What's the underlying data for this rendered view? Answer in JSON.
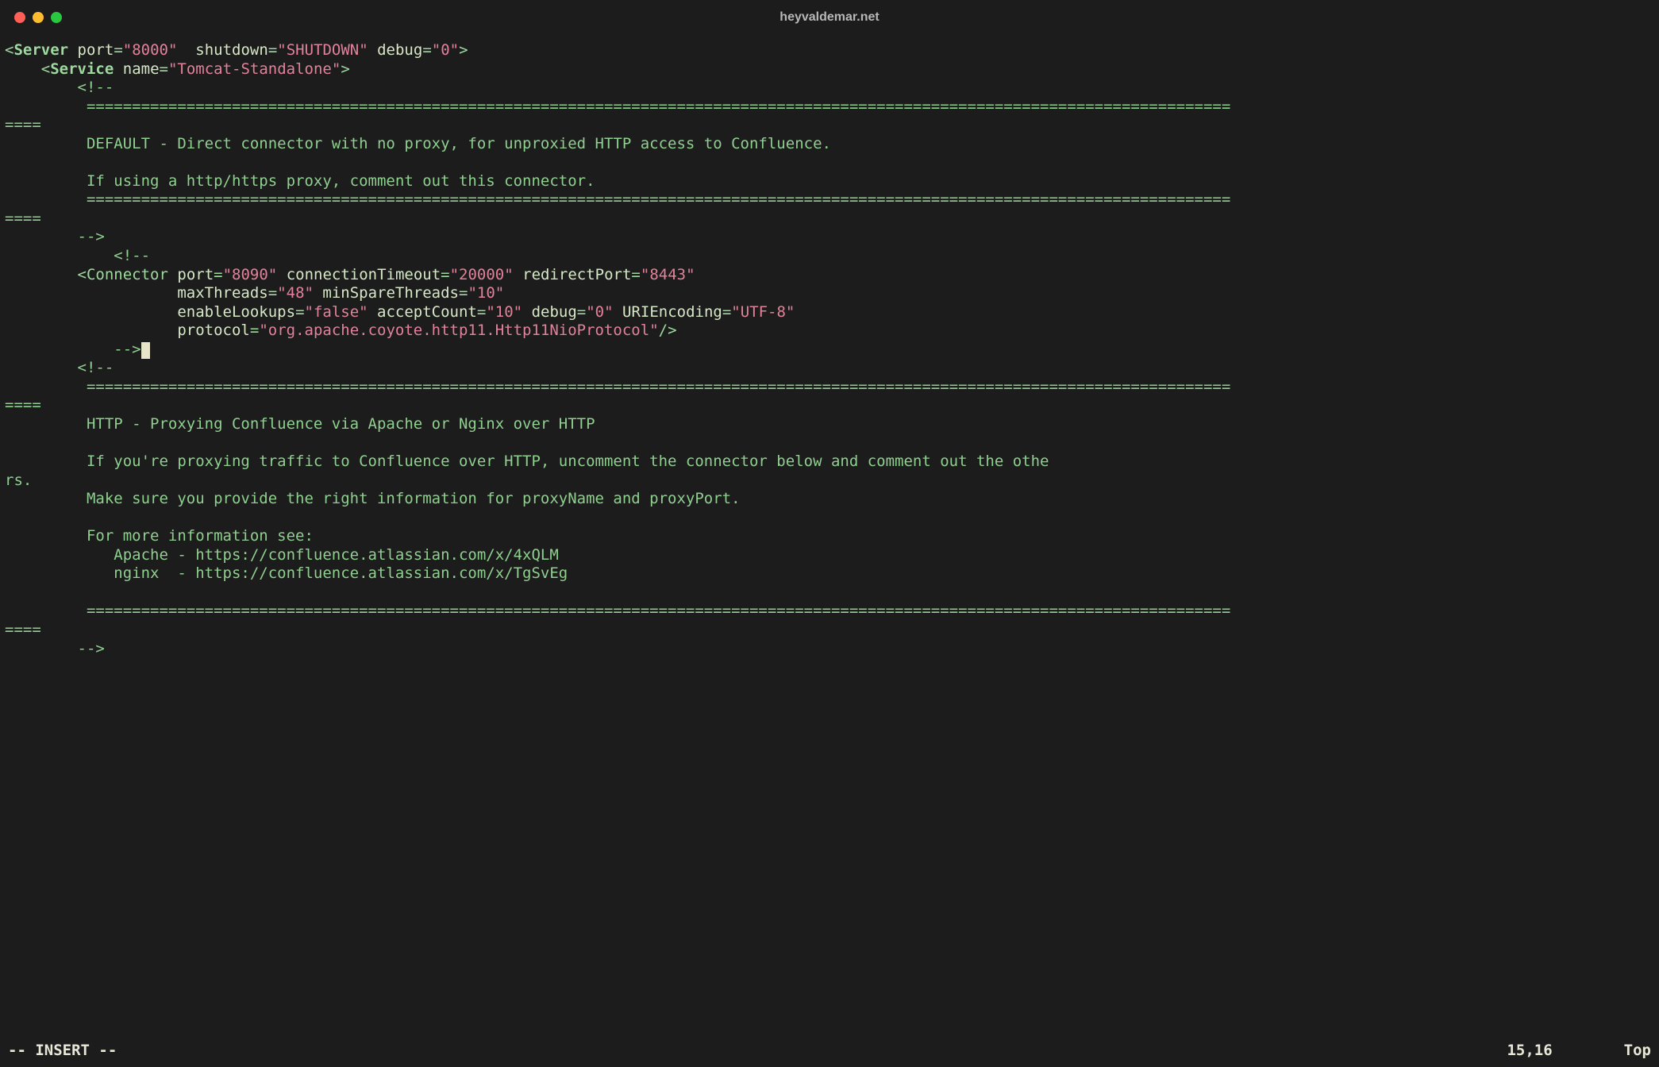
{
  "window": {
    "title": "heyvaldemar.net"
  },
  "status": {
    "mode": "-- INSERT --",
    "position": "15,16",
    "scroll": "Top"
  },
  "xml": {
    "server": {
      "tag": "Server",
      "port_attr": "port",
      "port_val": "\"8000\"",
      "shutdown_attr": "shutdown",
      "shutdown_val": "\"SHUTDOWN\"",
      "debug_attr": "debug",
      "debug_val": "\"0\""
    },
    "service": {
      "tag": "Service",
      "name_attr": "name",
      "name_val": "\"Tomcat-Standalone\""
    },
    "connector": {
      "tag": "Connector",
      "port_attr": "port",
      "port_val": "\"8090\"",
      "ct_attr": "connectionTimeout",
      "ct_val": "\"20000\"",
      "rp_attr": "redirectPort",
      "rp_val": "\"8443\"",
      "mt_attr": "maxThreads",
      "mt_val": "\"48\"",
      "mst_attr": "minSpareThreads",
      "mst_val": "\"10\"",
      "el_attr": "enableLookups",
      "el_val": "\"false\"",
      "ac_attr": "acceptCount",
      "ac_val": "\"10\"",
      "dbg_attr": "debug",
      "dbg_val": "\"0\"",
      "ue_attr": "URIEncoding",
      "ue_val": "\"UTF-8\"",
      "proto_attr": "protocol",
      "proto_val": "\"org.apache.coyote.http11.Http11NioProtocol\""
    }
  },
  "comment_open": "<!--",
  "comment_close": "-->",
  "rule_long": "         ==============================================================================================================================",
  "rule_wrap": "====",
  "default_block": {
    "l1": "         DEFAULT - Direct connector with no proxy, for unproxied HTTP access to Confluence.",
    "blank": "",
    "l2": "         If using a http/https proxy, comment out this connector."
  },
  "http_block": {
    "l1": "         HTTP - Proxying Confluence via Apache or Nginx over HTTP",
    "blank": "",
    "l2": "         If you're proxying traffic to Confluence over HTTP, uncomment the connector below and comment out the othe",
    "l2wrap": "rs.",
    "l3": "         Make sure you provide the right information for proxyName and proxyPort.",
    "l4": "         For more information see:",
    "l5": "            Apache - https://confluence.atlassian.com/x/4xQLM",
    "l6": "            nginx  - https://confluence.atlassian.com/x/TgSvEg"
  },
  "punct": {
    "lt": "<",
    "gt": ">",
    "eq": "=",
    "slashgt": "/>"
  }
}
